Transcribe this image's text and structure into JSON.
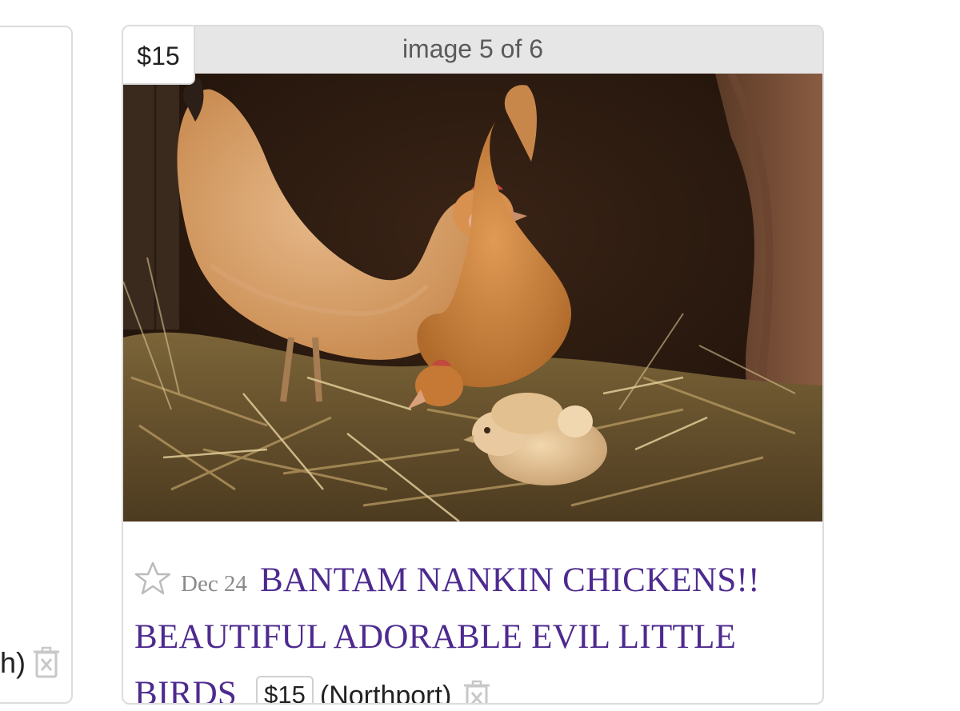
{
  "left_card": {
    "hood_fragment": "h)"
  },
  "listing": {
    "price_tag": "$15",
    "image_counter": "image 5 of 6",
    "date": "Dec 24",
    "title": "BANTAM NANKIN CHICKENS!! BEAUTIFUL ADORABLE EVIL LITTLE BIRDS",
    "price": "$15",
    "hood": "(Northport)",
    "photo_description_icon": "chicken-photo",
    "favorite_icon": "star-icon",
    "hide_icon": "trash-icon"
  },
  "colors": {
    "title_link": "#4d2a8f",
    "date": "#8a8a8a",
    "border": "#dcdcdc"
  }
}
